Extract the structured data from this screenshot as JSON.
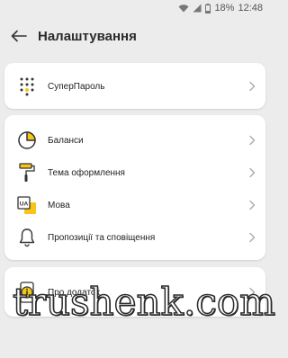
{
  "status_bar": {
    "battery": "18%",
    "time": "12:48"
  },
  "header": {
    "title": "Налаштування"
  },
  "sections": [
    {
      "items": [
        {
          "label": "СуперПароль",
          "icon": "keypad-icon"
        }
      ]
    },
    {
      "items": [
        {
          "label": "Баланси",
          "icon": "pie-chart-icon"
        },
        {
          "label": "Тема оформлення",
          "icon": "paint-roller-icon"
        },
        {
          "label": "Мова",
          "icon": "language-icon"
        },
        {
          "label": "Пропозиції та сповіщення",
          "icon": "bell-icon"
        }
      ]
    },
    {
      "items": [
        {
          "label": "Про додаток",
          "icon": "info-icon"
        }
      ]
    }
  ],
  "language_icon_text": "UA",
  "watermark": "trushenk.com",
  "colors": {
    "accent": "#f5c518",
    "background": "#ececec"
  }
}
